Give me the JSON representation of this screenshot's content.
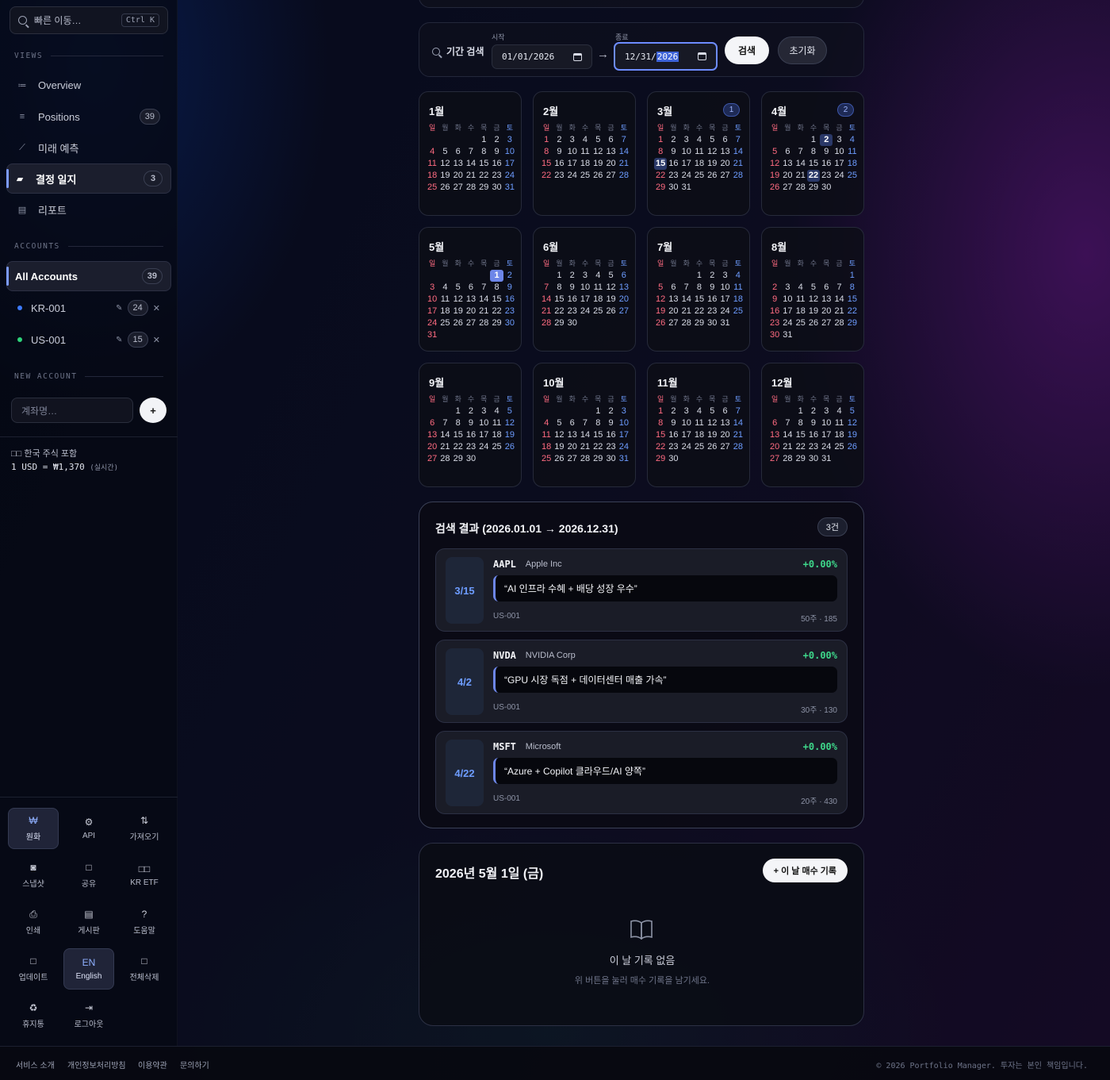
{
  "sidebar": {
    "search_placeholder": "빠른 이동…",
    "search_shortcut": "Ctrl K",
    "views_label": "VIEWS",
    "views": [
      {
        "label": "Overview",
        "icon": "list-icon",
        "count": ""
      },
      {
        "label": "Positions",
        "icon": "rows-icon",
        "count": "39"
      },
      {
        "label": "미래 예측",
        "icon": "trend-icon",
        "count": ""
      },
      {
        "label": "결정 일지",
        "icon": "book-icon",
        "count": "3",
        "active": true
      },
      {
        "label": "리포트",
        "icon": "document-icon",
        "count": ""
      }
    ],
    "accounts_label": "ACCOUNTS",
    "all_accounts": {
      "label": "All Accounts",
      "count": "39"
    },
    "accounts": [
      {
        "label": "KR-001",
        "count": "24",
        "color": "#3d7bff"
      },
      {
        "label": "US-001",
        "count": "15",
        "color": "#2ed47a"
      }
    ],
    "new_account_label": "NEW ACCOUNT",
    "new_account_placeholder": "계좌명…",
    "add_label": "+",
    "kr_note": "□□ 한국 주식 포함",
    "fx_rate": "1 USD = ₩1,370",
    "fx_note": "(실시간)",
    "tools": [
      {
        "label": "원화",
        "glyph": "₩",
        "icon": "won-icon",
        "active": true
      },
      {
        "label": "API",
        "glyph": "⚙",
        "icon": "gear-icon"
      },
      {
        "label": "가져오기",
        "glyph": "⇅",
        "icon": "import-icon"
      },
      {
        "label": "스냅샷",
        "glyph": "◙",
        "icon": "camera-icon"
      },
      {
        "label": "공유",
        "glyph": "□",
        "icon": "share-icon"
      },
      {
        "label": "KR ETF",
        "glyph": "□□",
        "icon": "etf-icon"
      },
      {
        "label": "인쇄",
        "glyph": "⎙",
        "icon": "print-icon"
      },
      {
        "label": "게시판",
        "glyph": "▤",
        "icon": "chat-icon"
      },
      {
        "label": "도움말",
        "glyph": "?",
        "icon": "help-icon"
      },
      {
        "label": "업데이트",
        "glyph": "□",
        "icon": "update-icon"
      },
      {
        "label": "English",
        "glyph": "EN",
        "icon": "language-icon",
        "active": true
      },
      {
        "label": "전체삭제",
        "glyph": "□",
        "icon": "delete-all-icon"
      },
      {
        "label": "휴지통",
        "glyph": "♻",
        "icon": "recycle-icon"
      },
      {
        "label": "로그아웃",
        "glyph": "⇥",
        "icon": "logout-icon"
      }
    ]
  },
  "range": {
    "label": "기간 검색",
    "start_label": "시작",
    "start_value": "01/01/2026",
    "end_label": "종료",
    "end_value_md": "12/31/",
    "end_value_year": "2026",
    "arrow": "→",
    "search_button": "검색",
    "reset_button": "초기화"
  },
  "weekdays": [
    "일",
    "월",
    "화",
    "수",
    "목",
    "금",
    "토"
  ],
  "calendar": {
    "year": 2026,
    "months": [
      {
        "title": "1월",
        "count": ""
      },
      {
        "title": "2월",
        "count": ""
      },
      {
        "title": "3월",
        "count": "1"
      },
      {
        "title": "4월",
        "count": "2"
      },
      {
        "title": "5월",
        "count": ""
      },
      {
        "title": "6월",
        "count": ""
      },
      {
        "title": "7월",
        "count": ""
      },
      {
        "title": "8월",
        "count": ""
      },
      {
        "title": "9월",
        "count": ""
      },
      {
        "title": "10월",
        "count": ""
      },
      {
        "title": "11월",
        "count": ""
      },
      {
        "title": "12월",
        "count": ""
      }
    ],
    "entry_days": [
      "3-15",
      "4-2",
      "4-22"
    ],
    "selected_day": "5-1",
    "today": "4-22"
  },
  "results": {
    "title": "검색 결과 (2026.01.01 → 2026.12.31)",
    "count": "3건",
    "entries": [
      {
        "date": "3/15",
        "ticker": "AAPL",
        "name": "Apple Inc",
        "return": "+0.00%",
        "quote": "“AI 인프라 수혜 + 배당 성장 우수”",
        "account": "US-001",
        "meta": "50주 · 185"
      },
      {
        "date": "4/2",
        "ticker": "NVDA",
        "name": "NVIDIA Corp",
        "return": "+0.00%",
        "quote": "“GPU 시장 독점 + 데이터센터 매출 가속”",
        "account": "US-001",
        "meta": "30주 · 130"
      },
      {
        "date": "4/22",
        "ticker": "MSFT",
        "name": "Microsoft",
        "return": "+0.00%",
        "quote": "“Azure + Copilot 클라우드/AI 양쪽”",
        "account": "US-001",
        "meta": "20주 · 430"
      }
    ]
  },
  "day_panel": {
    "title": "2026년 5월 1일 (금)",
    "add_button": "+ 이 날 매수 기록",
    "empty_title": "이 날 기록 없음",
    "empty_hint": "위 버튼을 눌러 매수 기록을 남기세요."
  },
  "footer": {
    "links": [
      "서비스 소개",
      "개인정보처리방침",
      "이용약관",
      "문의하기"
    ],
    "copyright": "© 2026 Portfolio Manager. 투자는 본인 책임입니다."
  }
}
